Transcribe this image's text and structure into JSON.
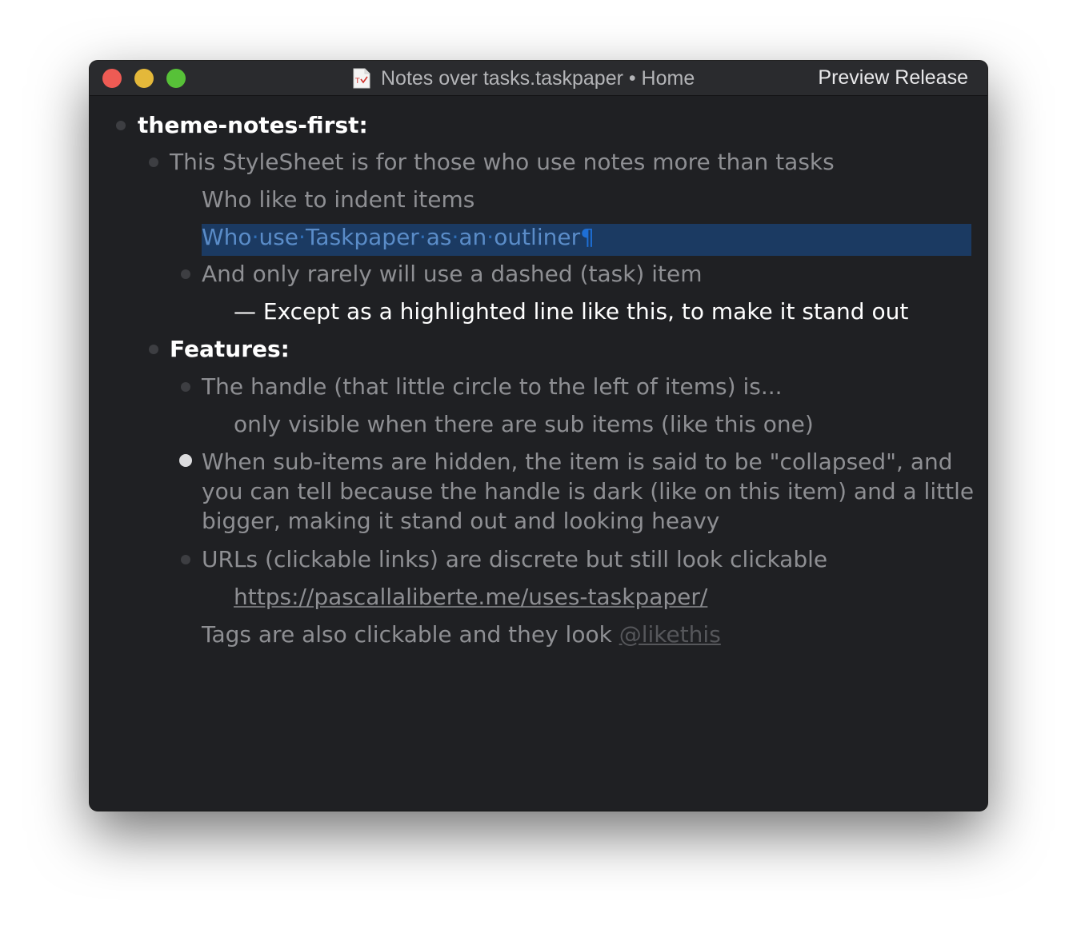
{
  "window": {
    "title": "Notes over tasks.taskpaper • Home",
    "badge": "Preview Release",
    "doc_icon": "taskpaper-document-icon"
  },
  "colors": {
    "background": "#1f2023",
    "titlebar": "#2a2b2e",
    "selection": "#1b3a62",
    "text_dim": "#8e8f93",
    "text_bright": "#ffffff"
  },
  "outline": {
    "project_title": "theme-notes-first:",
    "note_1": "This StyleSheet is for those who use notes more than tasks",
    "note_2": "Who like to indent items",
    "note_3_words": [
      "Who",
      "use",
      "Taskpaper",
      "as",
      "an",
      "outliner"
    ],
    "note_3_pilcrow": "¶",
    "note_4": "And only rarely will use a dashed (task) item",
    "task_1": "— Except as a highlighted line like this, to make it stand out",
    "features_title": "Features:",
    "feature_1": "The handle (that little circle to the left of items) is...",
    "feature_1_sub": "only visible when there are sub items (like this one)",
    "feature_2_line1": "When sub-items are hidden, the item is said to be \"collapsed\", and",
    "feature_2_line2": "you can tell because the handle is dark (like on this item) and a little",
    "feature_2_line3": "bigger, making it stand out and looking heavy",
    "feature_3": "URLs (clickable links) are discrete but still look clickable",
    "feature_3_link": "https://pascallaliberte.me/uses-taskpaper/",
    "feature_4_prefix": "Tags are also clickable and they look ",
    "feature_4_tag": "@likethis"
  }
}
